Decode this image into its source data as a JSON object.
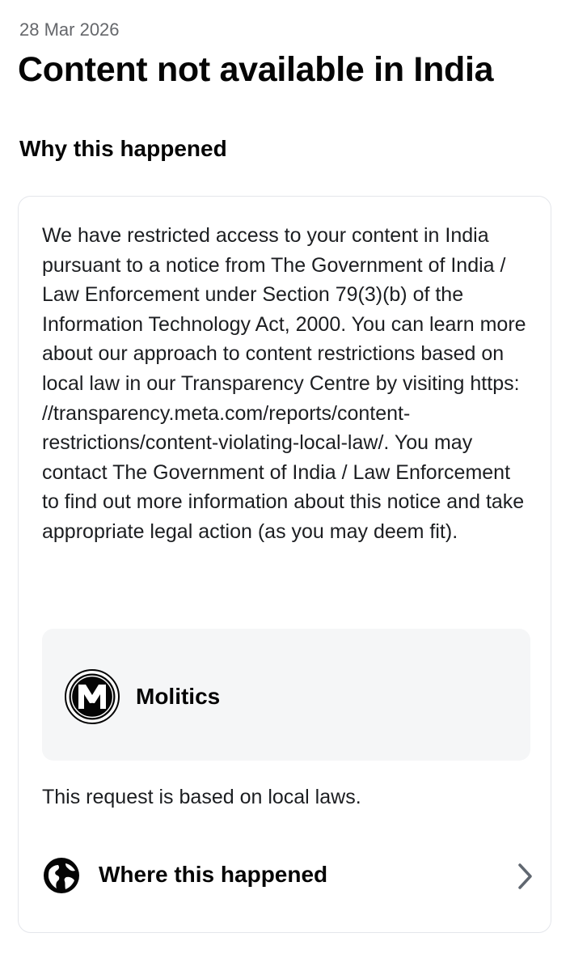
{
  "header": {
    "date": "28 Mar 2026",
    "title": "Content not available in India"
  },
  "section": {
    "heading": "Why this happened"
  },
  "card": {
    "notice_text": "We have restricted access to your content in India pursuant to a notice from The Government of India / Law Enforcement under Section 79(3)(b) of the Information Technology Act, 2000. You can learn more about our approach to content restrictions based on local law in our Transparency Centre by visiting https: //transparency.meta.com/reports/content-restrictions/content-violating-local-law/. You may contact The Government of India / Law Enforcement to find out more information about this notice and take appropriate legal action (as you may deem fit).",
    "account": {
      "name": "Molitics",
      "avatar_icon": "molitics-logo-icon"
    },
    "basis_text": "This request is based on local laws.",
    "where_row": {
      "label": "Where this happened",
      "icon": "globe-icon",
      "chevron": "chevron-right-icon"
    }
  },
  "colors": {
    "text_primary": "#050505",
    "text_secondary": "#65676b",
    "card_border": "#e4e6eb",
    "account_bg": "#f5f6f7"
  }
}
